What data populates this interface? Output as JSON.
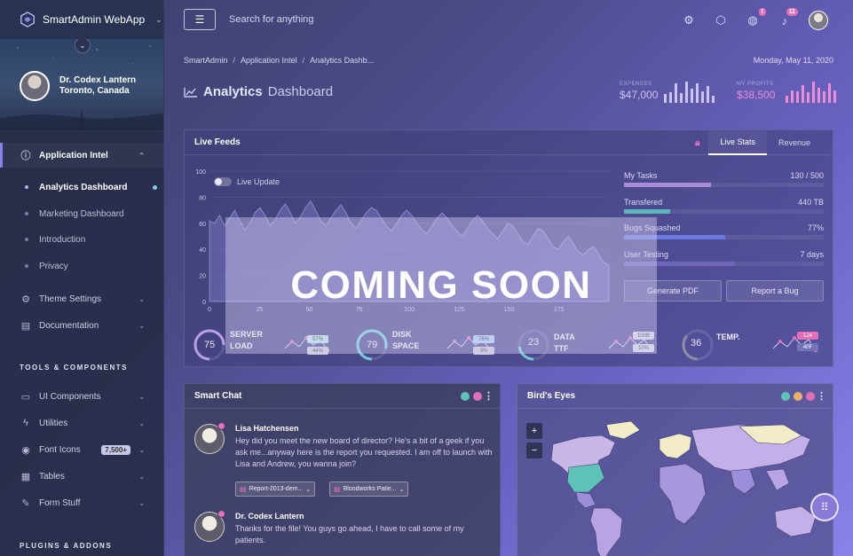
{
  "app": {
    "name": "SmartAdmin WebApp",
    "caret": "⌄"
  },
  "profile": {
    "name": "Dr. Codex Lantern",
    "location": "Toronto, Canada",
    "toggle": "⌄"
  },
  "sidebar": {
    "groups": [
      {
        "label": "Application Intel",
        "icon": "info-icon",
        "glyph": "ⓘ",
        "expanded": true,
        "children": [
          {
            "label": "Analytics Dashboard",
            "active": true
          },
          {
            "label": "Marketing Dashboard"
          },
          {
            "label": "Introduction"
          },
          {
            "label": "Privacy"
          }
        ]
      },
      {
        "label": "Theme Settings",
        "icon": "gear-icon",
        "glyph": "⚙"
      },
      {
        "label": "Documentation",
        "icon": "book-icon",
        "glyph": "▤"
      }
    ],
    "heading_tools": "TOOLS & COMPONENTS",
    "tools": [
      {
        "label": "UI Components",
        "icon": "window-icon",
        "glyph": "▭"
      },
      {
        "label": "Utilities",
        "icon": "bolt-icon",
        "glyph": "ϟ"
      },
      {
        "label": "Font Icons",
        "icon": "pin-icon",
        "glyph": "◉",
        "badge": "7,500+"
      },
      {
        "label": "Tables",
        "icon": "table-icon",
        "glyph": "▦"
      },
      {
        "label": "Form Stuff",
        "icon": "edit-icon",
        "glyph": "✎"
      }
    ],
    "heading_plugins": "PLUGINS & ADDONS"
  },
  "topbar": {
    "menu_glyph": "☰",
    "search_placeholder": "Search for anything",
    "notifications_badge_1": "!",
    "notifications_badge_2": "11"
  },
  "breadcrumb": [
    "SmartAdmin",
    "Application Intel",
    "Analytics Dashb..."
  ],
  "date": "Monday, May 11, 2020",
  "page_title": {
    "bold": "Analytics",
    "light": "Dashboard"
  },
  "header_stats": {
    "expenses": {
      "label": "EXPENSES",
      "value": "$47,000",
      "color": "#c9c4f0",
      "bars": [
        0.4,
        0.5,
        0.9,
        0.45,
        1.0,
        0.65,
        0.9,
        0.55,
        0.8,
        0.35
      ]
    },
    "profits": {
      "label": "MY PROFITS",
      "value": "$38,500",
      "color": "#e98fd6",
      "bars": [
        0.35,
        0.6,
        0.55,
        0.85,
        0.5,
        1.0,
        0.7,
        0.55,
        0.9,
        0.6
      ]
    }
  },
  "live_feeds": {
    "title": "Live Feeds",
    "tabs": [
      "Live Stats",
      "Revenue"
    ],
    "active_tab": "Live Stats",
    "toggle_label": "Live Update",
    "stats": [
      {
        "label": "My Tasks",
        "value": "130 / 500",
        "fill": 0.66,
        "color": "#a98bd8"
      },
      {
        "label": "Transfered",
        "value": "440 TB",
        "fill": 0.35,
        "color": "#5db6bc"
      },
      {
        "label": "Bugs Squashed",
        "value": "77%",
        "fill": 0.77,
        "color": "#6a7ae0"
      },
      {
        "label": "User Testing",
        "value": "7 days",
        "fill": 0.84,
        "color": "#6e66b8"
      }
    ],
    "buttons": [
      "Generate PDF",
      "Report a Bug"
    ],
    "coming_soon": "COMING SOON",
    "gauges": [
      {
        "value": "75",
        "label_1": "SERVER",
        "label_2": "LOAD",
        "pct": 0.75,
        "color": "#b6a0e8",
        "pill_1": "57%",
        "pill_2": "44%",
        "pill_1_color": "#b7e0e4",
        "pill_2_color": "#c9c7d8"
      },
      {
        "value": "79",
        "label_1": "DISK",
        "label_2": "SPACE",
        "pct": 0.79,
        "color": "#6fd0dc",
        "pill_1": "76%",
        "pill_2": "3%",
        "pill_1_color": "#aac8f2",
        "pill_2_color": "#c9c7d8"
      },
      {
        "value": "23",
        "label_1": "DATA",
        "label_2": "TTF",
        "pct": 0.23,
        "color": "#73c8d0",
        "pill_1": "100B",
        "pill_2": "10%",
        "pill_1_color": "#d2d0e2",
        "pill_2_color": "#d2d0e2"
      },
      {
        "value": "36",
        "label_1": "TEMP.",
        "label_2": "",
        "pct": 0.36,
        "color": "#8f8da8",
        "pill_1": "124",
        "pill_2": "40F",
        "pill_1_color": "#e26fb7",
        "pill_2_color": "#7472b8"
      }
    ]
  },
  "chart_data": {
    "type": "area",
    "title": "",
    "x_ticks": [
      "0",
      "25",
      "50",
      "75",
      "100",
      "125",
      "150",
      "175"
    ],
    "y_ticks": [
      "0",
      "20",
      "40",
      "60",
      "80",
      "100"
    ],
    "xlim": [
      0,
      200
    ],
    "ylim": [
      0,
      100
    ],
    "series": [
      {
        "values": [
          62,
          60,
          66,
          58,
          64,
          70,
          62,
          55,
          60,
          68,
          72,
          66,
          58,
          63,
          70,
          75,
          68,
          60,
          65,
          72,
          77,
          70,
          62,
          58,
          64,
          70,
          74,
          68,
          60,
          56,
          62,
          68,
          72,
          70,
          64,
          58,
          54,
          60,
          66,
          70,
          66,
          60,
          55,
          52,
          58,
          64,
          68,
          64,
          58,
          54,
          50,
          56,
          62,
          66,
          62,
          56,
          52,
          48,
          54,
          60,
          58,
          52,
          46,
          44,
          50,
          56,
          54,
          48,
          42,
          40,
          46,
          50,
          44,
          38,
          36,
          40,
          42,
          36,
          30,
          28
        ]
      }
    ]
  },
  "smart_chat": {
    "title": "Smart Chat",
    "messages": [
      {
        "name": "Lisa Hatchensen",
        "text": "Hey did you meet the new board of director? He's a bit of a geek if you ask me...anyway here is the report you requested. I am off to launch with Lisa and Andrew, you wanna join?",
        "attachments": [
          "Report-2013-dem...",
          "Bloodworks Patie..."
        ]
      },
      {
        "name": "Dr. Codex Lantern",
        "text": "Thanks for the file! You guys go ahead, I have to call some of my patients."
      }
    ],
    "dot_colors": [
      "#5fc2b8",
      "#e06fb6"
    ]
  },
  "birds_eye": {
    "title": "Bird's Eyes",
    "zoom_in": "+",
    "zoom_out": "−",
    "dot_colors": [
      "#5fc2b8",
      "#e8b06a",
      "#e06fb6"
    ]
  },
  "fab_glyph": "⠿",
  "colors": {
    "accent": "#8a80e6",
    "pink": "#e26fb7",
    "teal": "#5fc2b8"
  }
}
